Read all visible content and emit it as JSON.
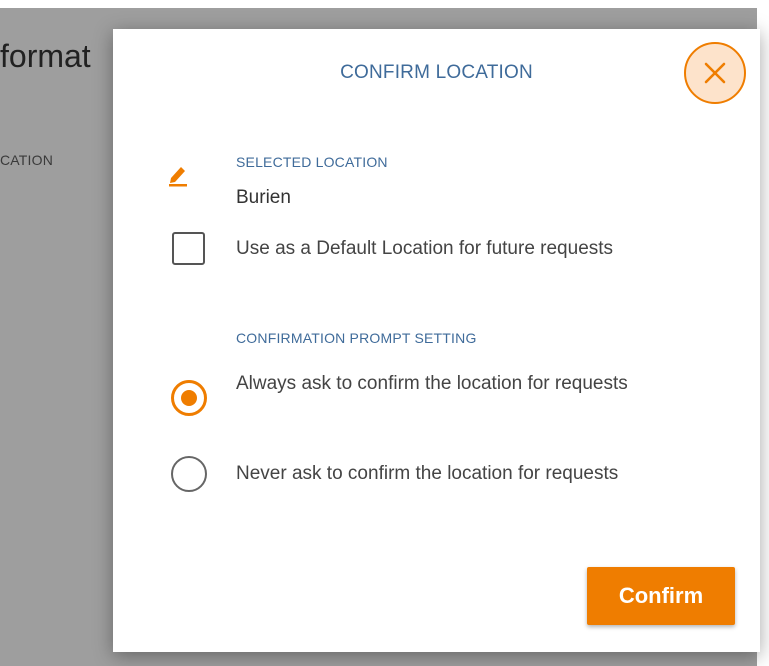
{
  "background": {
    "page_title_fragment": "format",
    "field_label_fragment": "CATION"
  },
  "modal": {
    "title": "CONFIRM LOCATION",
    "close_icon": "close-icon",
    "selected_location": {
      "label": "SELECTED LOCATION",
      "value": "Burien",
      "icon": "edit-icon"
    },
    "default_option": {
      "label": "Use as a Default Location for future requests",
      "checked": false
    },
    "prompt_setting": {
      "label": "CONFIRMATION PROMPT SETTING",
      "options": [
        {
          "label": "Always ask to confirm the location for requests",
          "selected": true
        },
        {
          "label": "Never ask to confirm the location for requests",
          "selected": false
        }
      ]
    },
    "confirm_label": "Confirm"
  },
  "colors": {
    "accent": "#ef7d00",
    "heading": "#3f6b9a",
    "overlay": "#9e9e9e"
  }
}
